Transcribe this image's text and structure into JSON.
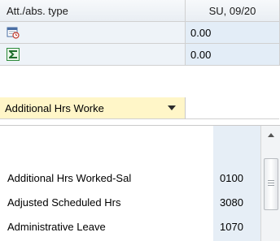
{
  "table": {
    "header": {
      "type_col": "Att./abs. type",
      "date_col": "SU, 09/20"
    },
    "rows": [
      {
        "icon": "calendar-clock-icon",
        "value": "0.00"
      },
      {
        "icon": "sigma-sum-icon",
        "value": "0.00"
      }
    ]
  },
  "dropdown": {
    "selected": "Additional Hrs Worke",
    "options": [
      {
        "label": "",
        "code": ""
      },
      {
        "label": "Additional Hrs Worked-Sal",
        "code": "0100"
      },
      {
        "label": "Adjusted Scheduled Hrs",
        "code": "3080"
      },
      {
        "label": "Administrative Leave",
        "code": "1070"
      }
    ]
  },
  "colors": {
    "header_bg": "#eef2f6",
    "selected_field_bg": "#fff6c8",
    "code_column_bg": "#e6eef6",
    "sigma_green": "#2e8b3d"
  }
}
